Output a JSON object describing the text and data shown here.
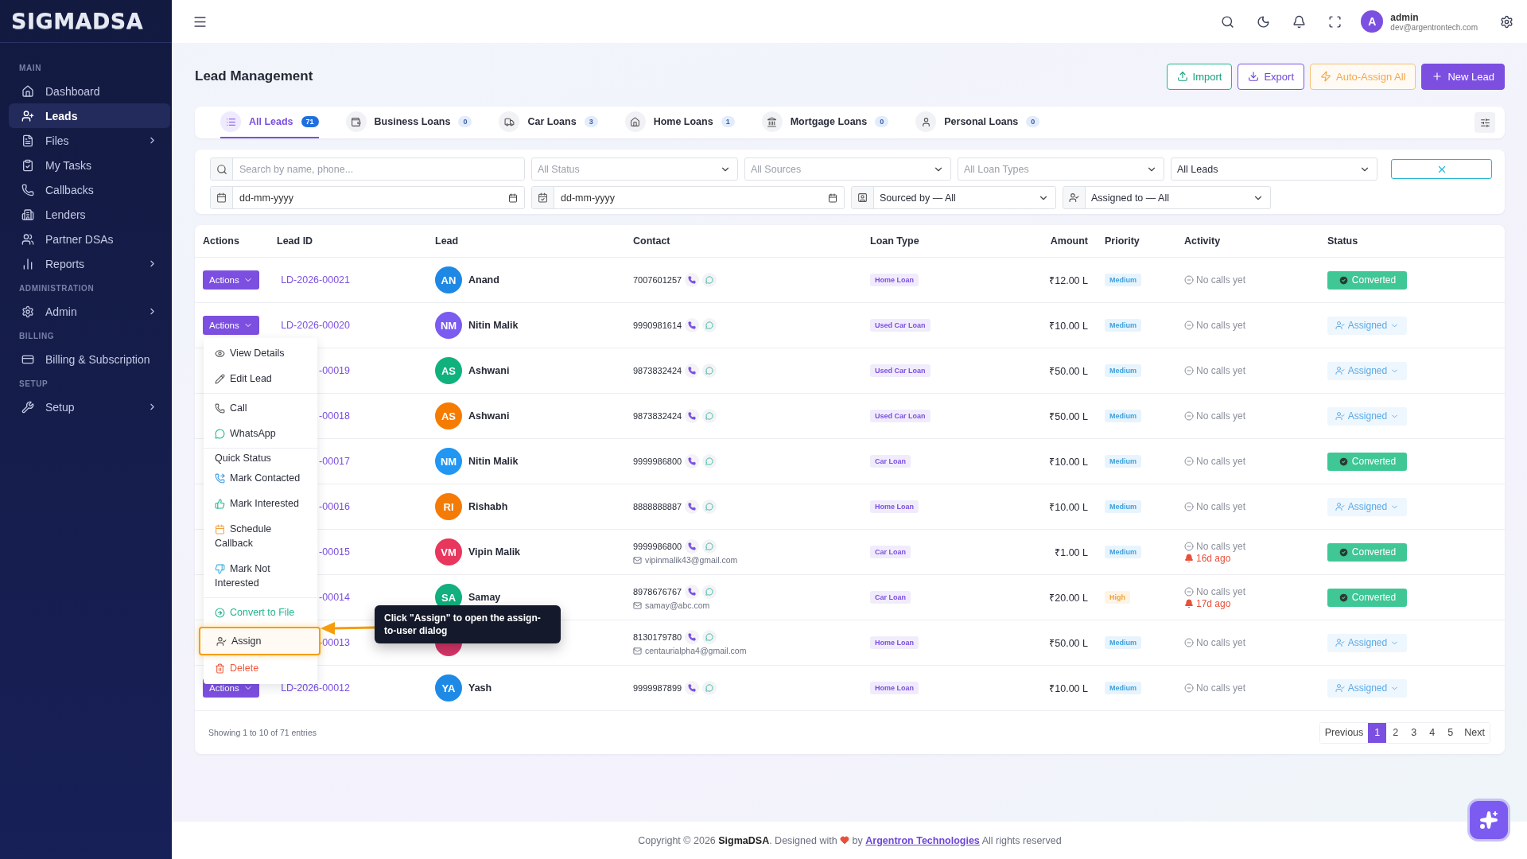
{
  "sidebar": {
    "logo": "SIGMADSA",
    "sections": [
      {
        "heading": "MAIN",
        "items": [
          {
            "label": "Dashboard",
            "selected": false,
            "expandable": false
          },
          {
            "label": "Leads",
            "selected": true,
            "expandable": false
          },
          {
            "label": "Files",
            "selected": false,
            "expandable": true
          },
          {
            "label": "My Tasks",
            "selected": false,
            "expandable": false
          },
          {
            "label": "Callbacks",
            "selected": false,
            "expandable": false
          },
          {
            "label": "Lenders",
            "selected": false,
            "expandable": false
          },
          {
            "label": "Partner DSAs",
            "selected": false,
            "expandable": false
          },
          {
            "label": "Reports",
            "selected": false,
            "expandable": true
          }
        ]
      },
      {
        "heading": "ADMINISTRATION",
        "items": [
          {
            "label": "Admin",
            "selected": false,
            "expandable": true
          }
        ]
      },
      {
        "heading": "BILLING",
        "items": [
          {
            "label": "Billing & Subscription",
            "selected": false,
            "expandable": false
          }
        ]
      },
      {
        "heading": "SETUP",
        "items": [
          {
            "label": "Setup",
            "selected": false,
            "expandable": true
          }
        ]
      }
    ]
  },
  "topbar": {
    "avatar": "A",
    "user_name": "admin",
    "user_email": "dev@argentrontech.com"
  },
  "page": {
    "title": "Lead Management",
    "buttons": [
      {
        "label": "Import",
        "kind": "import"
      },
      {
        "label": "Export",
        "kind": "export"
      },
      {
        "label": "Auto-Assign All",
        "kind": "auto"
      },
      {
        "label": "New Lead",
        "kind": "new"
      }
    ]
  },
  "tabs": [
    {
      "label": "All Leads",
      "count": "71",
      "selected": true
    },
    {
      "label": "Business Loans",
      "count": "0",
      "selected": false
    },
    {
      "label": "Car Loans",
      "count": "3",
      "selected": false
    },
    {
      "label": "Home Loans",
      "count": "1",
      "selected": false
    },
    {
      "label": "Mortgage Loans",
      "count": "0",
      "selected": false
    },
    {
      "label": "Personal Loans",
      "count": "0",
      "selected": false
    }
  ],
  "filters": {
    "search": {
      "placeholder": "Search by name, phone..."
    },
    "selects": [
      {
        "placeholder": "All Status"
      },
      {
        "placeholder": "All Sources"
      },
      {
        "placeholder": "All Loan Types"
      },
      {
        "value": "All Leads"
      }
    ],
    "dates": [
      {
        "placeholder": "dd-mm-yyyy"
      },
      {
        "placeholder": "dd-mm-yyyy"
      }
    ],
    "people": [
      {
        "value": "Sourced by — All"
      },
      {
        "value": "Assigned to — All"
      }
    ]
  },
  "table": {
    "columns": [
      "Actions",
      "Lead ID",
      "Lead",
      "Contact",
      "Loan Type",
      "Amount",
      "Priority",
      "Activity",
      "Status"
    ],
    "rows": [
      {
        "actions": "Actions",
        "lead_id": "LD-2026-00021",
        "initials": "AN",
        "name": "Anand",
        "color": "#1e88e5",
        "phone": "7007601257",
        "loan_type": "Home Loan",
        "amount": "₹12.00 L",
        "priority": {
          "label": "Medium",
          "kind": "medium"
        },
        "activity": "No calls yet",
        "status": {
          "label": "Converted",
          "kind": "converted"
        }
      },
      {
        "actions": "Actions",
        "lead_id": "LD-2026-00020",
        "initials": "NM",
        "name": "Nitin Malik",
        "color": "#7b5cf0",
        "phone": "9990981614",
        "loan_type": "Used Car Loan",
        "amount": "₹10.00 L",
        "priority": {
          "label": "Medium",
          "kind": "medium"
        },
        "activity": "No calls yet",
        "status": {
          "label": "Assigned",
          "kind": "assigned"
        }
      },
      {
        "lead_id": "-00019",
        "initials": "AS",
        "name": "Ashwani",
        "color": "#10b17d",
        "phone": "9873832424",
        "loan_type": "Used Car Loan",
        "amount": "₹50.00 L",
        "priority": {
          "label": "Medium",
          "kind": "medium"
        },
        "activity": "No calls yet",
        "status": {
          "label": "Assigned",
          "kind": "assigned"
        }
      },
      {
        "lead_id": "-00018",
        "initials": "AS",
        "name": "Ashwani",
        "color": "#f57c00",
        "phone": "9873832424",
        "loan_type": "Used Car Loan",
        "amount": "₹50.00 L",
        "priority": {
          "label": "Medium",
          "kind": "medium"
        },
        "activity": "No calls yet",
        "status": {
          "label": "Assigned",
          "kind": "assigned"
        }
      },
      {
        "lead_id": "-00017",
        "initials": "NM",
        "name": "Nitin Malik",
        "color": "#2196f3",
        "phone": "9999986800",
        "loan_type": "Car Loan",
        "amount": "₹10.00 L",
        "priority": {
          "label": "Medium",
          "kind": "medium"
        },
        "activity": "No calls yet",
        "status": {
          "label": "Converted",
          "kind": "converted"
        }
      },
      {
        "lead_id": "-00016",
        "initials": "RI",
        "name": "Rishabh",
        "color": "#f47b06",
        "phone": "8888888887",
        "loan_type": "Home Loan",
        "amount": "₹10.00 L",
        "priority": {
          "label": "Medium",
          "kind": "medium"
        },
        "activity": "No calls yet",
        "status": {
          "label": "Assigned",
          "kind": "assigned"
        }
      },
      {
        "lead_id": "-00015",
        "initials": "VM",
        "name": "Vipin Malik",
        "color": "#e8365d",
        "phone": "9999986800",
        "email": "vipinmalik43@gmail.com",
        "loan_type": "Car Loan",
        "amount": "₹1.00 L",
        "priority": {
          "label": "Medium",
          "kind": "medium"
        },
        "activity": "No calls yet",
        "reminder": "16d ago",
        "status": {
          "label": "Converted",
          "kind": "converted"
        }
      },
      {
        "lead_id": "-00014",
        "initials": "SA",
        "name": "Samay",
        "color": "#11b07e",
        "phone": "8978676767",
        "email": "samay@abc.com",
        "loan_type": "Car Loan",
        "amount": "₹20.00 L",
        "priority": {
          "label": "High",
          "kind": "high"
        },
        "activity": "No calls yet",
        "reminder": "17d ago",
        "status": {
          "label": "Converted",
          "kind": "converted"
        }
      },
      {
        "lead_id": "-00013",
        "color": "#d9366a",
        "phone": "8130179780",
        "email": "centaurialpha4@gmail.com",
        "loan_type": "Home Loan",
        "amount": "₹50.00 L",
        "priority": {
          "label": "Medium",
          "kind": "medium"
        },
        "activity": "No calls yet",
        "status": {
          "label": "Assigned",
          "kind": "assigned"
        }
      },
      {
        "actions": "Actions",
        "lead_id": "LD-2026-00012",
        "initials": "YA",
        "name": "Yash",
        "color": "#1e8ae6",
        "phone": "9999987899",
        "loan_type": "Home Loan",
        "amount": "₹10.00 L",
        "priority": {
          "label": "Medium",
          "kind": "medium"
        },
        "activity": "No calls yet",
        "status": {
          "label": "Assigned",
          "kind": "assigned"
        }
      }
    ],
    "summary": "Showing 1 to 10 of 71 entries"
  },
  "pagination": {
    "previous": "Previous",
    "next": "Next",
    "pages": [
      {
        "label": "1",
        "selected": true
      },
      {
        "label": "2",
        "selected": false
      },
      {
        "label": "3",
        "selected": false
      },
      {
        "label": "4",
        "selected": false
      },
      {
        "label": "5",
        "selected": false
      }
    ]
  },
  "actions_menu": {
    "items": [
      {
        "kind": "item",
        "label": "View Details",
        "highlighted": false
      },
      {
        "kind": "item",
        "label": "Edit Lead",
        "highlighted": false,
        "divider_after": true
      },
      {
        "kind": "item",
        "label": "Call",
        "highlighted": false
      },
      {
        "kind": "item",
        "label": "WhatsApp",
        "highlighted": false,
        "divider_after": true
      },
      {
        "kind": "heading",
        "label": "Quick Status"
      },
      {
        "kind": "item",
        "label": "Mark Contacted",
        "highlighted": false
      },
      {
        "kind": "item",
        "label": "Mark Interested",
        "highlighted": false
      },
      {
        "kind": "item",
        "label": "Schedule Callback",
        "highlighted": false
      },
      {
        "kind": "item",
        "label": "Mark Not Interested",
        "highlighted": false,
        "divider_after": true
      },
      {
        "kind": "success",
        "label": "Convert to File",
        "highlighted": false
      },
      {
        "kind": "item",
        "label": "Assign",
        "highlighted": true
      },
      {
        "kind": "danger",
        "label": "Delete",
        "highlighted": false
      }
    ]
  },
  "tooltip": "Click \"Assign\" to open the assign-to-user dialog",
  "footer": {
    "before": "Copyright © 2026 **SigmaDSA**. Designed with",
    "by": "by",
    "link": "Argentron Technologies",
    "after": "All rights reserved"
  }
}
